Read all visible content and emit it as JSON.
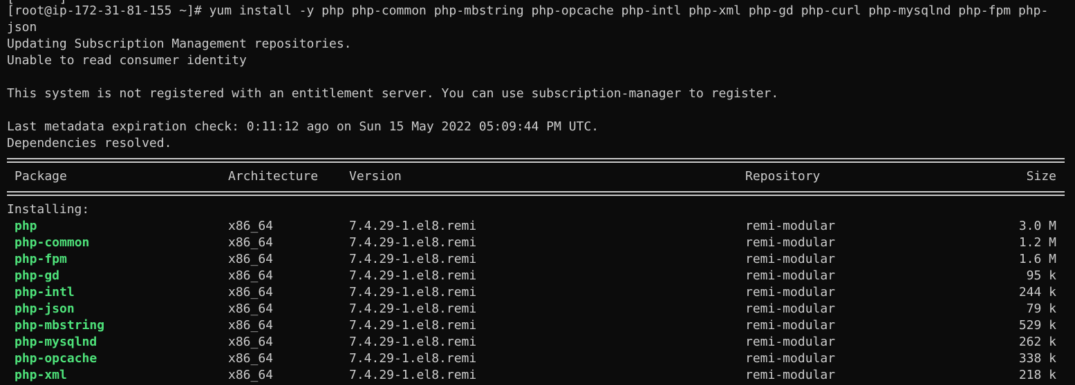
{
  "terminal": {
    "prompt_top_fragment": "[      ] ",
    "command_line_1": "[root@ip-172-31-81-155 ~]# yum install -y php php-common php-mbstring php-opcache php-intl php-xml php-gd php-curl php-mysqlnd php-fpm php-",
    "command_line_2": "json",
    "lines_after_command": [
      "Updating Subscription Management repositories.",
      "Unable to read consumer identity",
      "",
      "This system is not registered with an entitlement server. You can use subscription-manager to register.",
      "",
      "Last metadata expiration check: 0:11:12 ago on Sun 15 May 2022 05:09:44 PM UTC.",
      "Dependencies resolved."
    ],
    "table": {
      "headers": {
        "package": "Package",
        "architecture": "Architecture",
        "version": "Version",
        "repository": "Repository",
        "size": "Size"
      },
      "section_label": "Installing:",
      "rows": [
        {
          "package": "php",
          "arch": "x86_64",
          "version": "7.4.29-1.el8.remi",
          "repo": "remi-modular",
          "size": "3.0 M"
        },
        {
          "package": "php-common",
          "arch": "x86_64",
          "version": "7.4.29-1.el8.remi",
          "repo": "remi-modular",
          "size": "1.2 M"
        },
        {
          "package": "php-fpm",
          "arch": "x86_64",
          "version": "7.4.29-1.el8.remi",
          "repo": "remi-modular",
          "size": "1.6 M"
        },
        {
          "package": "php-gd",
          "arch": "x86_64",
          "version": "7.4.29-1.el8.remi",
          "repo": "remi-modular",
          "size": "95 k"
        },
        {
          "package": "php-intl",
          "arch": "x86_64",
          "version": "7.4.29-1.el8.remi",
          "repo": "remi-modular",
          "size": "244 k"
        },
        {
          "package": "php-json",
          "arch": "x86_64",
          "version": "7.4.29-1.el8.remi",
          "repo": "remi-modular",
          "size": "79 k"
        },
        {
          "package": "php-mbstring",
          "arch": "x86_64",
          "version": "7.4.29-1.el8.remi",
          "repo": "remi-modular",
          "size": "529 k"
        },
        {
          "package": "php-mysqlnd",
          "arch": "x86_64",
          "version": "7.4.29-1.el8.remi",
          "repo": "remi-modular",
          "size": "262 k"
        },
        {
          "package": "php-opcache",
          "arch": "x86_64",
          "version": "7.4.29-1.el8.remi",
          "repo": "remi-modular",
          "size": "338 k"
        },
        {
          "package": "php-xml",
          "arch": "x86_64",
          "version": "7.4.29-1.el8.remi",
          "repo": "remi-modular",
          "size": "218 k"
        }
      ]
    },
    "colors": {
      "background": "#0c0c0c",
      "text": "#cccccc",
      "package_name": "#4ee27a"
    }
  }
}
